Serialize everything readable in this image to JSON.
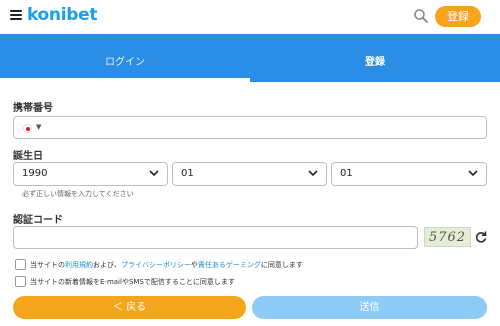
{
  "header": {
    "logo_text": "konibet",
    "register_label": "登録"
  },
  "tabs": {
    "login_label": "ログイン",
    "register_label": "登録"
  },
  "form": {
    "phone_label": "携帯番号",
    "phone_placeholder": "",
    "birthday_label": "誕生日",
    "year_value": "1990",
    "month_value": "01",
    "day_value": "01",
    "birthday_hint": "必ず正しい情報を入力してください",
    "captcha_label": "認証コード",
    "captcha_value": "",
    "captcha_code": "5762",
    "terms_prefix": "当サイトの",
    "terms_link1": "利用規約",
    "terms_mid1": "および、",
    "terms_link2": "プライバシーポリシー",
    "terms_mid2": "や",
    "terms_link3": "責任あるゲーミング",
    "terms_suffix": "に同意します",
    "newsletter_text": "当サイトの新着情報をE-mailやSMSで配信することに同意します"
  },
  "buttons": {
    "back_label": "＜ 戻る",
    "submit_label": "送信"
  },
  "colors": {
    "brand_blue": "#2a8ee6",
    "accent_orange": "#f5a31a",
    "submit_disabled": "#8ecbf4",
    "link": "#1a8fd6"
  }
}
